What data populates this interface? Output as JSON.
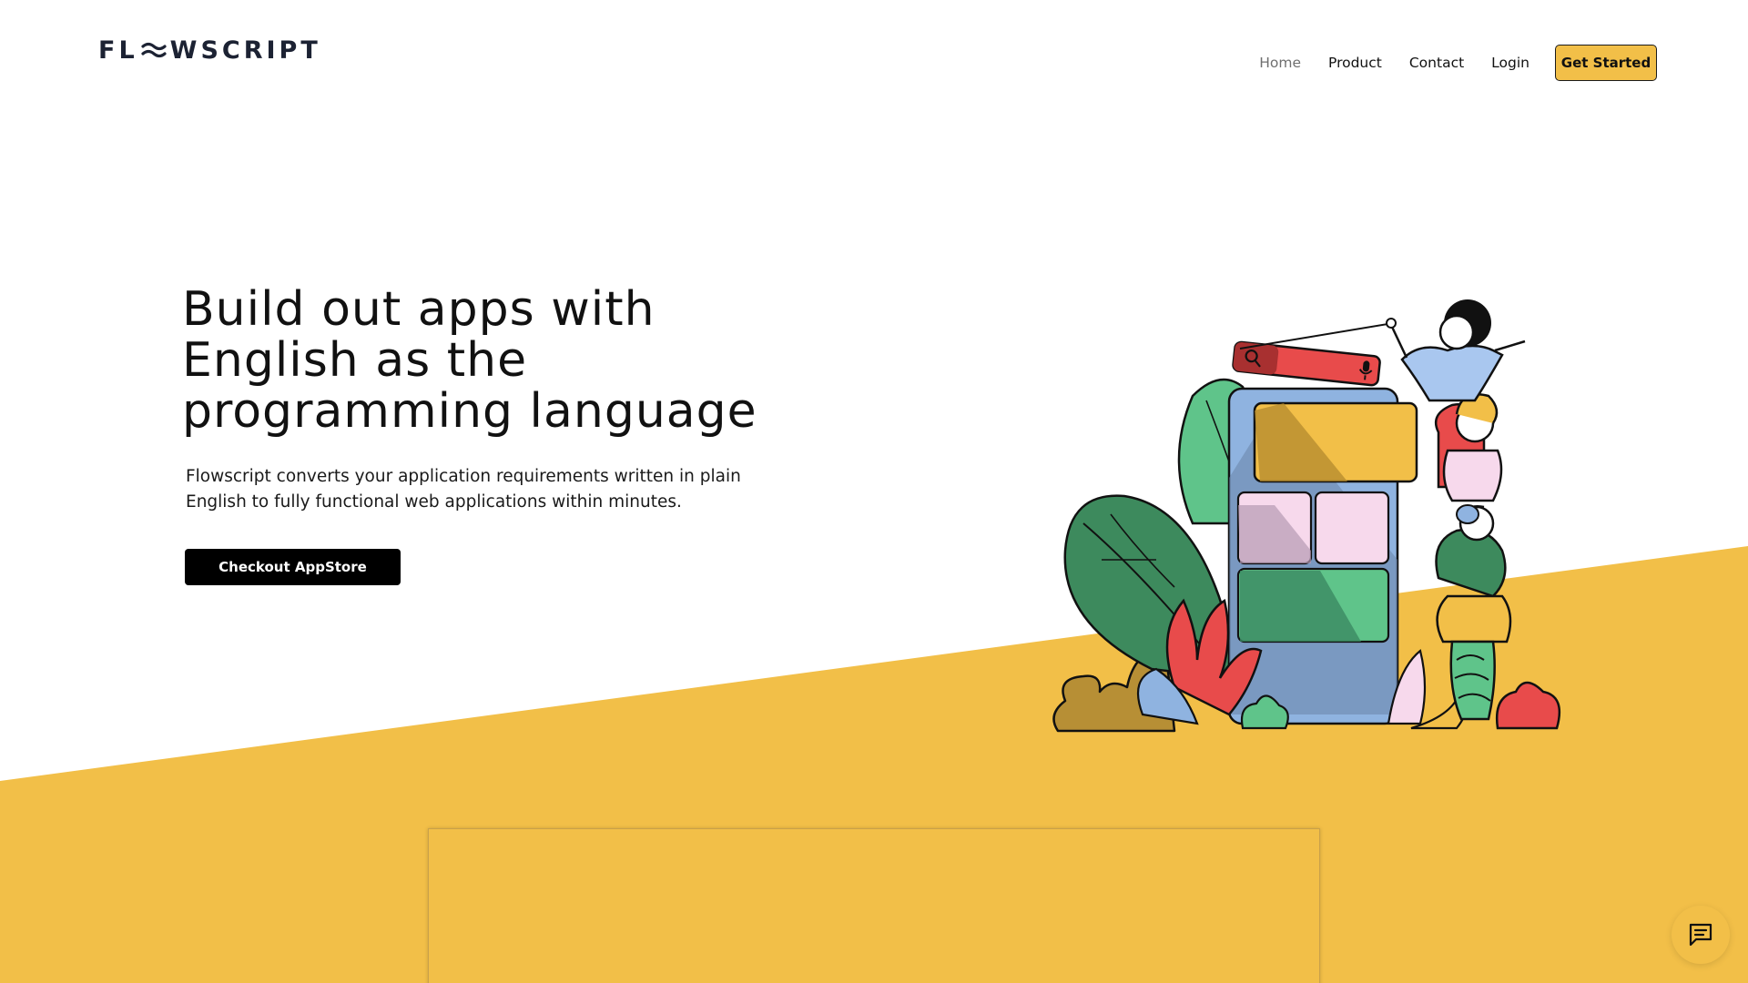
{
  "brand": {
    "logo_left": "FL",
    "logo_right": "WSCRIPT",
    "logo_mark_icon": "wave-o-icon"
  },
  "nav": {
    "items": [
      {
        "label": "Home",
        "active": true
      },
      {
        "label": "Product",
        "active": false
      },
      {
        "label": "Contact",
        "active": false
      },
      {
        "label": "Login",
        "active": false
      }
    ],
    "cta_label": "Get Started"
  },
  "hero": {
    "title": "Build out apps with English as the programming language",
    "description": "Flowscript converts your application requirements written in plain English to fully functional web applications within minutes.",
    "cta_label": "Checkout AppStore"
  },
  "illustration": {
    "icons": [
      "search-icon",
      "microphone-icon"
    ]
  },
  "chat_widget": {
    "icon": "chat-icon"
  },
  "colors": {
    "accent_yellow": "#f2bf48",
    "text_dark": "#111111",
    "nav_active": "#6f6f6f",
    "button_black": "#000000"
  }
}
